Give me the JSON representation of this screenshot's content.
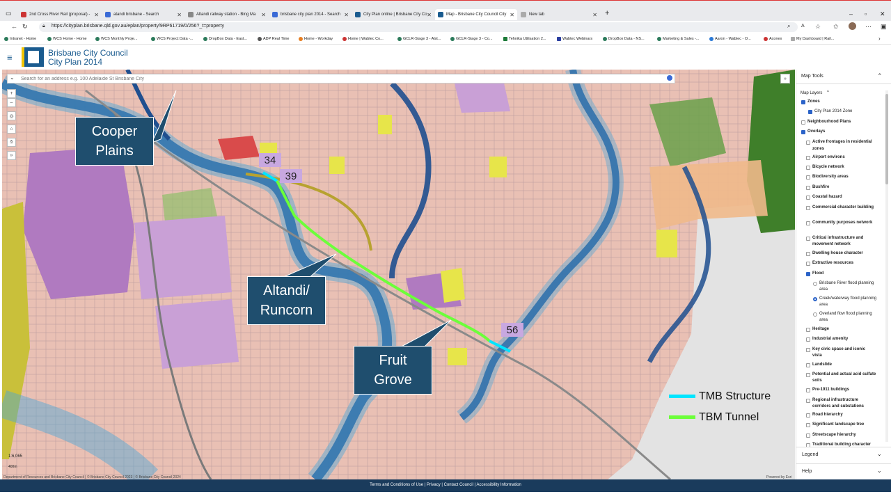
{
  "browser": {
    "tabs": [
      {
        "label": "2nd Cross River Rail (proposal) -"
      },
      {
        "label": "atandi brisbane - Search"
      },
      {
        "label": "Altandi railway station - Bing Ma"
      },
      {
        "label": "brisbane city plan 2014 - Search"
      },
      {
        "label": "City Plan online | Brisbane City Co"
      },
      {
        "label": "Map - Brisbane City Council City"
      },
      {
        "label": "New tab"
      }
    ],
    "url": "https://cityplan.brisbane.qld.gov.au/eplan/property/9RP61719/0/256?_t=property",
    "bookmarks": [
      "Intranet - Home",
      "WCS Home - Home",
      "WCS Monthly Proje...",
      "WCS Project Data -...",
      "DropBox Data - East...",
      "ADP Real Time",
      "Home - Workday",
      "Home | Wabtec Co...",
      "GCLR-Stage 3 - Alst...",
      "GCLR-Stage 3 - Co...",
      "Tehnika Utilisation 2...",
      "Wabtec Webinars",
      "DropBox Data - NS...",
      "Marketing & Sales -...",
      "Aaron - Wabtec - O...",
      "Aconex",
      "My Dashboard | Rail..."
    ]
  },
  "app": {
    "title_line1": "Brisbane City Council",
    "title_line2": "City Plan 2014"
  },
  "map": {
    "search_placeholder": "Search for an address e.g. 100 Adelaide St Brisbane City",
    "scale_label": "1:6,065",
    "scale_bar": "400m",
    "attribution": "Department of Resources and Brisbane City Council | © Brisbane City Council 2023 | © Brisbane City Council 2024",
    "powered_by": "Powered by Esri",
    "callouts": {
      "cooper": [
        "Cooper",
        "Plains"
      ],
      "altandi": [
        "Altandi/",
        "Runcorn"
      ],
      "fruit": [
        "Fruit",
        "Grove"
      ]
    },
    "numbers": [
      "34",
      "39",
      "56"
    ],
    "legend": [
      {
        "label": "TMB Structure",
        "color": "#00e5ff"
      },
      {
        "label": "TBM Tunnel",
        "color": "#6cff3a"
      }
    ]
  },
  "sidebar": {
    "title": "Map Tools",
    "map_layers": "Map Layers",
    "items": [
      {
        "label": "Zones",
        "checked": true,
        "bold": true
      },
      {
        "label": "City Plan 2014 Zone",
        "checked": true,
        "bold": false
      },
      {
        "label": "Neighbourhood Plans",
        "checked": false,
        "bold": true
      },
      {
        "label": "Overlays",
        "checked": true,
        "bold": true
      },
      {
        "label": "Active frontages in residential",
        "checked": false,
        "bold": true
      },
      {
        "label": "zones",
        "checked": false,
        "bold": true
      },
      {
        "label": "Airport environs",
        "checked": false,
        "bold": true
      },
      {
        "label": "Bicycle network",
        "checked": false,
        "bold": true
      },
      {
        "label": "Biodiversity areas",
        "checked": false,
        "bold": true
      },
      {
        "label": "Bushfire",
        "checked": false,
        "bold": true
      },
      {
        "label": "Coastal hazard",
        "checked": false,
        "bold": true
      },
      {
        "label": "Commercial character building",
        "checked": false,
        "bold": true
      },
      {
        "label": "Community purposes network",
        "checked": false,
        "bold": true
      },
      {
        "label": "Critical infrastructure and",
        "checked": false,
        "bold": true
      },
      {
        "label": "movement network",
        "checked": false,
        "bold": true
      },
      {
        "label": "Dwelling house character",
        "checked": false,
        "bold": true
      },
      {
        "label": "Extractive resources",
        "checked": false,
        "bold": true
      },
      {
        "label": "Flood",
        "checked": true,
        "bold": true
      },
      {
        "label": "Brisbane River flood planning",
        "checked": false,
        "bold": false
      },
      {
        "label": "area",
        "checked": false,
        "bold": false
      },
      {
        "label": "Creek/waterway flood planning",
        "checked": true,
        "bold": false
      },
      {
        "label": "area",
        "checked": false,
        "bold": false
      },
      {
        "label": "Overland flow flood planning",
        "checked": false,
        "bold": false
      },
      {
        "label": "area",
        "checked": false,
        "bold": false
      },
      {
        "label": "Heritage",
        "checked": false,
        "bold": true
      },
      {
        "label": "Industrial amenity",
        "checked": false,
        "bold": true
      },
      {
        "label": "Key civic space and iconic",
        "checked": false,
        "bold": true
      },
      {
        "label": "vista",
        "checked": false,
        "bold": true
      },
      {
        "label": "Landslide",
        "checked": false,
        "bold": true
      },
      {
        "label": "Potential and actual acid sulfate",
        "checked": false,
        "bold": true
      },
      {
        "label": "soils",
        "checked": false,
        "bold": true
      },
      {
        "label": "Pre-1911 buildings",
        "checked": false,
        "bold": true
      },
      {
        "label": "Regional infrastructure",
        "checked": false,
        "bold": true
      },
      {
        "label": "corridors and substations",
        "checked": false,
        "bold": true
      },
      {
        "label": "Road hierarchy",
        "checked": false,
        "bold": true
      },
      {
        "label": "Significant landscape tree",
        "checked": false,
        "bold": true
      },
      {
        "label": "Streetscape hierarchy",
        "checked": false,
        "bold": true
      },
      {
        "label": "Traditional building character",
        "checked": false,
        "bold": true
      }
    ],
    "legend_label": "Legend",
    "help_label": "Help"
  },
  "footer": {
    "links": "Terms and Conditions of Use  |  Privacy  |  Contact Council  |  Accessibility Information"
  },
  "colors": {
    "brand": "#1a5b8f",
    "callout": "#1f4e6e",
    "footer": "#1a3b5c",
    "number_label": "#c8a8e0"
  }
}
